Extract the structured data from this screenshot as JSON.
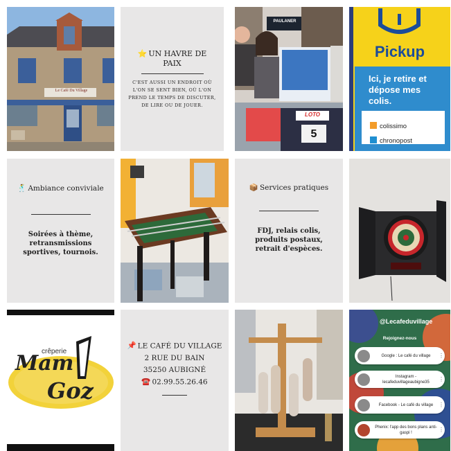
{
  "tile_havre": {
    "icon": "⭐",
    "title": "UN HAVRE DE PAIX",
    "body": "C'EST AUSSI UN ENDROIT OÙ L'ON SE SENT BIEN, OÙ L'ON PREND LE TEMPS DE DISCUTER, DE LIRE OU DE JOUER."
  },
  "tile_ambiance": {
    "icon": "🕺",
    "title": "Ambiance conviviale",
    "body": "Soirées à thème, retransmissions sportives, tournois."
  },
  "tile_services": {
    "icon": "📦",
    "title": "Services pratiques",
    "body": "FDJ, relais colis, produits postaux, retrait d'espèces."
  },
  "tile_contact": {
    "icon_pin": "📌",
    "name": "LE CAFÉ DU VILLAGE",
    "street": "2 RUE DU BAIN",
    "city": "35250 AUBIGNÉ",
    "icon_phone": "☎️",
    "phone": "02.99.55.26.46"
  },
  "photo_cafe": {
    "sign": "Le Café Du Village"
  },
  "photo_counter": {
    "sign": "PAULANER",
    "lotto": "LOTO",
    "number": "5"
  },
  "photo_pickup": {
    "brand": "Pickup",
    "tagline": "Ici, je retire et dépose mes colis.",
    "partner1": "colissimo",
    "partner2": "chronopost"
  },
  "photo_creperie": {
    "small": "crêperie",
    "brand1": "Mam",
    "brand2": "Goz"
  },
  "instagram": {
    "handle": "@Lecafeduvillage",
    "join": "Rejoignez-nous",
    "links": [
      "Google : Le café du village",
      "Instagram - lecafeduvillageaubigne35",
      "Facebook - Le café du village",
      "Phenix: l'app des bons plans anti-gaspi !"
    ]
  },
  "colors": {
    "tile_bg": "#e8e7e7",
    "pickup_yellow": "#f6d21a",
    "pickup_blue": "#2f8ccd"
  }
}
